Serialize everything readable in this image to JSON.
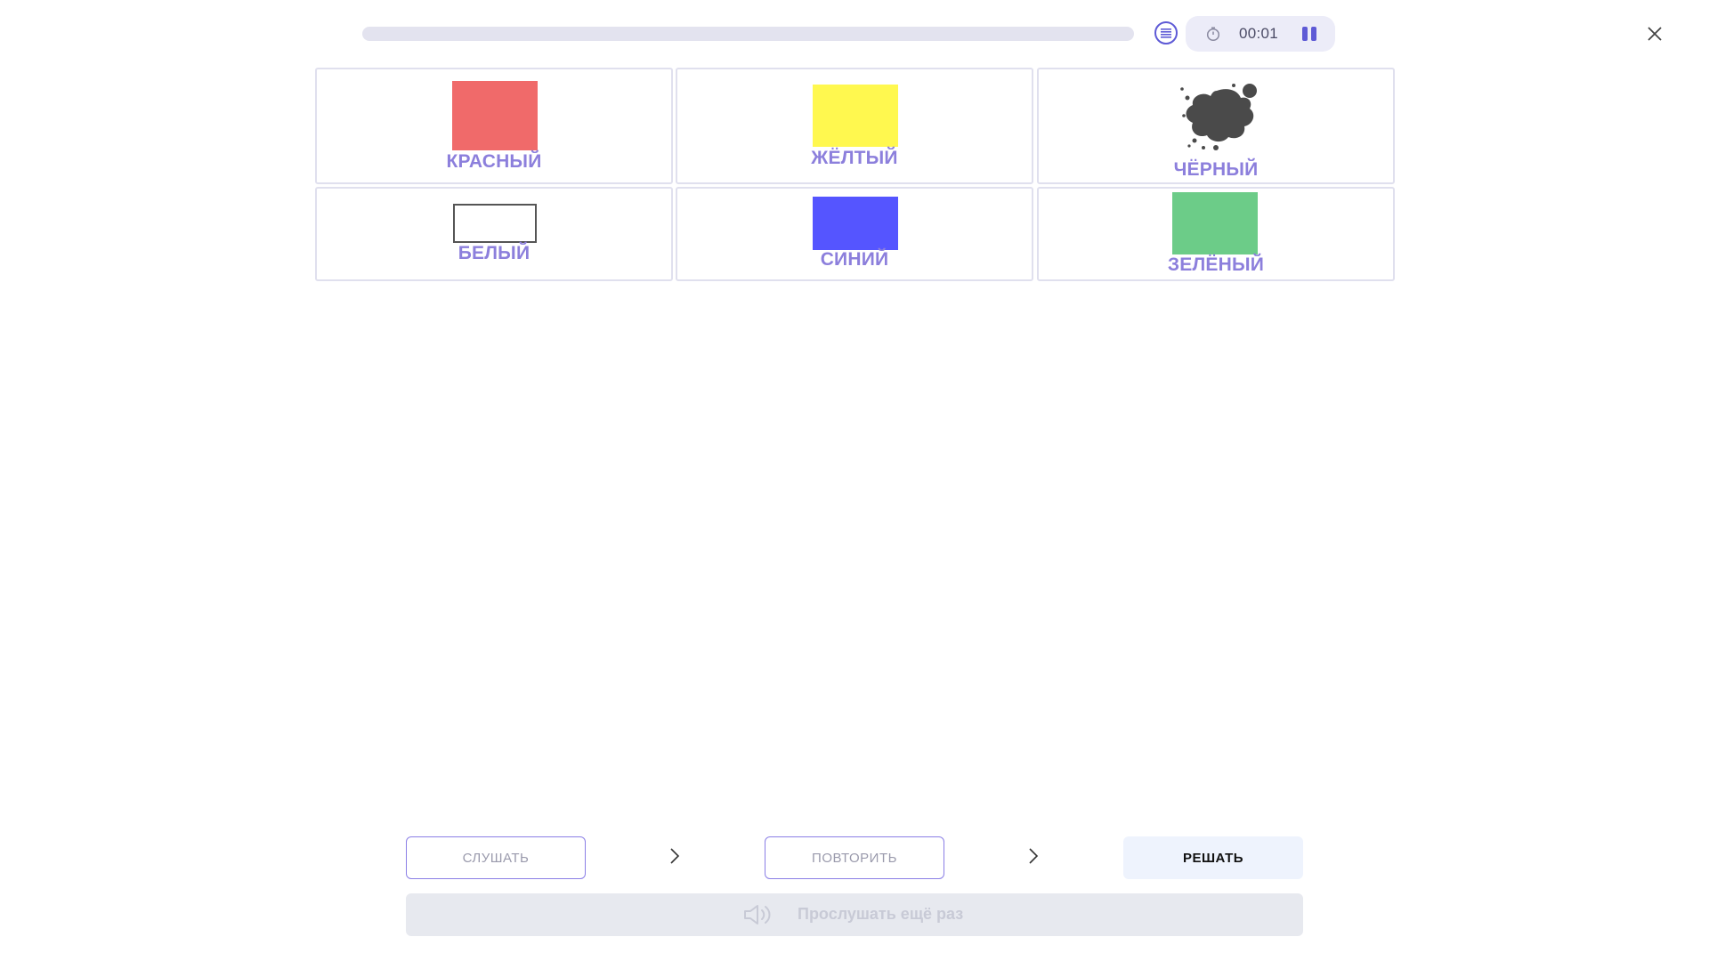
{
  "progress": {
    "value_percent": 0
  },
  "timer": {
    "time": "00:01"
  },
  "icons": {
    "list": "list-icon",
    "timer": "stopwatch-icon",
    "pause": "pause-icon",
    "close": "close-icon",
    "chevron": "chevron-right-icon",
    "speaker": "speaker-icon"
  },
  "colors": {
    "accent": "#5e5ad6",
    "label": "#8c7fdc",
    "red": "#f06a6a",
    "yellow": "#fff84f",
    "black": "#4a4a4a",
    "white": "#ffffff",
    "blue": "#5555ff",
    "green": "#6ccc88"
  },
  "cards": [
    {
      "label": "КРАСНЫЙ"
    },
    {
      "label": "ЖЁЛТЫЙ"
    },
    {
      "label": "ЧЁРНЫЙ"
    },
    {
      "label": "БЕЛЫЙ"
    },
    {
      "label": "СИНИЙ"
    },
    {
      "label": "ЗЕЛЁНЫЙ"
    }
  ],
  "steps": {
    "listen": "СЛУШАТЬ",
    "repeat": "ПОВТОРИТЬ",
    "solve": "РЕШАТЬ"
  },
  "listen_again": {
    "label": "Прослушать ещё раз"
  }
}
